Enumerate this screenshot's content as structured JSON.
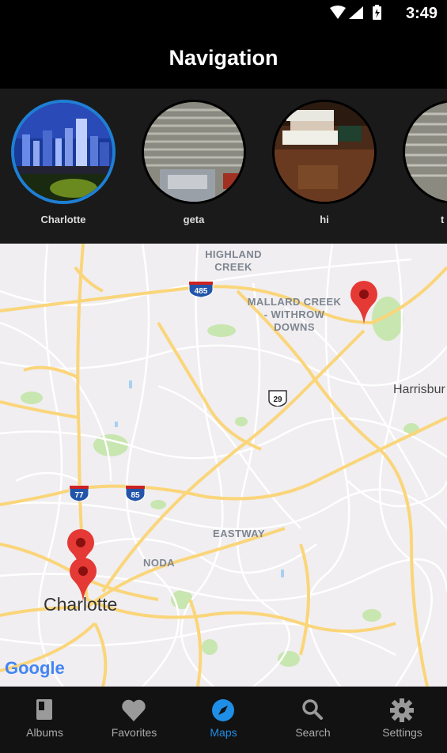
{
  "status_bar": {
    "time": "3:49"
  },
  "app_bar": {
    "title": "Navigation"
  },
  "albums": [
    {
      "label": "Charlotte",
      "selected": true
    },
    {
      "label": "geta",
      "selected": false
    },
    {
      "label": "hi",
      "selected": false
    },
    {
      "label": "t",
      "selected": false
    }
  ],
  "map": {
    "labels": {
      "highland_creek": "HIGHLAND CREEK",
      "mallard_creek": "MALLARD CREEK - WITHROW DOWNS",
      "eastway": "EASTWAY",
      "noda": "NODA",
      "charlotte": "Charlotte",
      "harrisburg": "Harrisbur"
    },
    "shields": {
      "i485": "485",
      "us29": "29",
      "i77": "77",
      "i85": "85"
    },
    "attribution": "Google"
  },
  "bottom_nav": [
    {
      "label": "Albums",
      "icon": "album-icon",
      "active": false
    },
    {
      "label": "Favorites",
      "icon": "heart-icon",
      "active": false
    },
    {
      "label": "Maps",
      "icon": "compass-icon",
      "active": true
    },
    {
      "label": "Search",
      "icon": "search-icon",
      "active": false
    },
    {
      "label": "Settings",
      "icon": "gear-icon",
      "active": false
    }
  ],
  "colors": {
    "accent": "#1f8ee6",
    "marker": "#e53935",
    "road": "#fdd663"
  }
}
